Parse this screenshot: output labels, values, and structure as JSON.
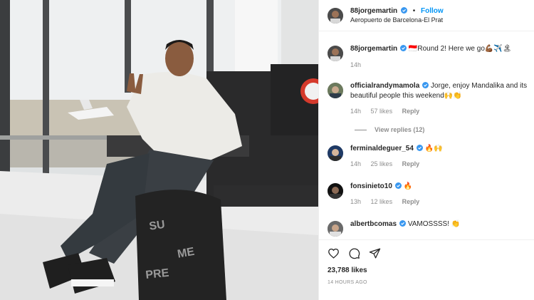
{
  "header": {
    "username": "88jorgemartin",
    "follow_label": "Follow",
    "separator": "•",
    "location": "Aeropuerto de Barcelona-El Prat"
  },
  "caption": {
    "username": "88jorgemartin",
    "text": "🇮🇩Round 2! Here we go💪🏾✈️🏝",
    "time": "14h"
  },
  "comments": [
    {
      "username": "officialrandymamola",
      "text": "Jorge, enjoy Mandalika and its beautiful people this weekend🙌👏",
      "time": "14h",
      "likes": "57 likes",
      "reply": "Reply"
    },
    {
      "username": "ferminaldeguer_54",
      "text": "🔥🙌",
      "time": "14h",
      "likes": "25 likes",
      "reply": "Reply"
    },
    {
      "username": "fonsinieto10",
      "text": "🔥",
      "time": "13h",
      "likes": "12 likes",
      "reply": "Reply"
    },
    {
      "username": "albertbcomas",
      "text": "VAMOSSSS! 👏"
    }
  ],
  "view_replies": "View replies (12)",
  "actions": {
    "icons": [
      "heart-icon",
      "comment-icon",
      "share-icon"
    ]
  },
  "likes_count": "23,788 likes",
  "posted_ago": "14 HOURS AGO",
  "colors": {
    "accent": "#0095f6",
    "verified": "#3897f0",
    "muted": "#8e8e8e"
  }
}
